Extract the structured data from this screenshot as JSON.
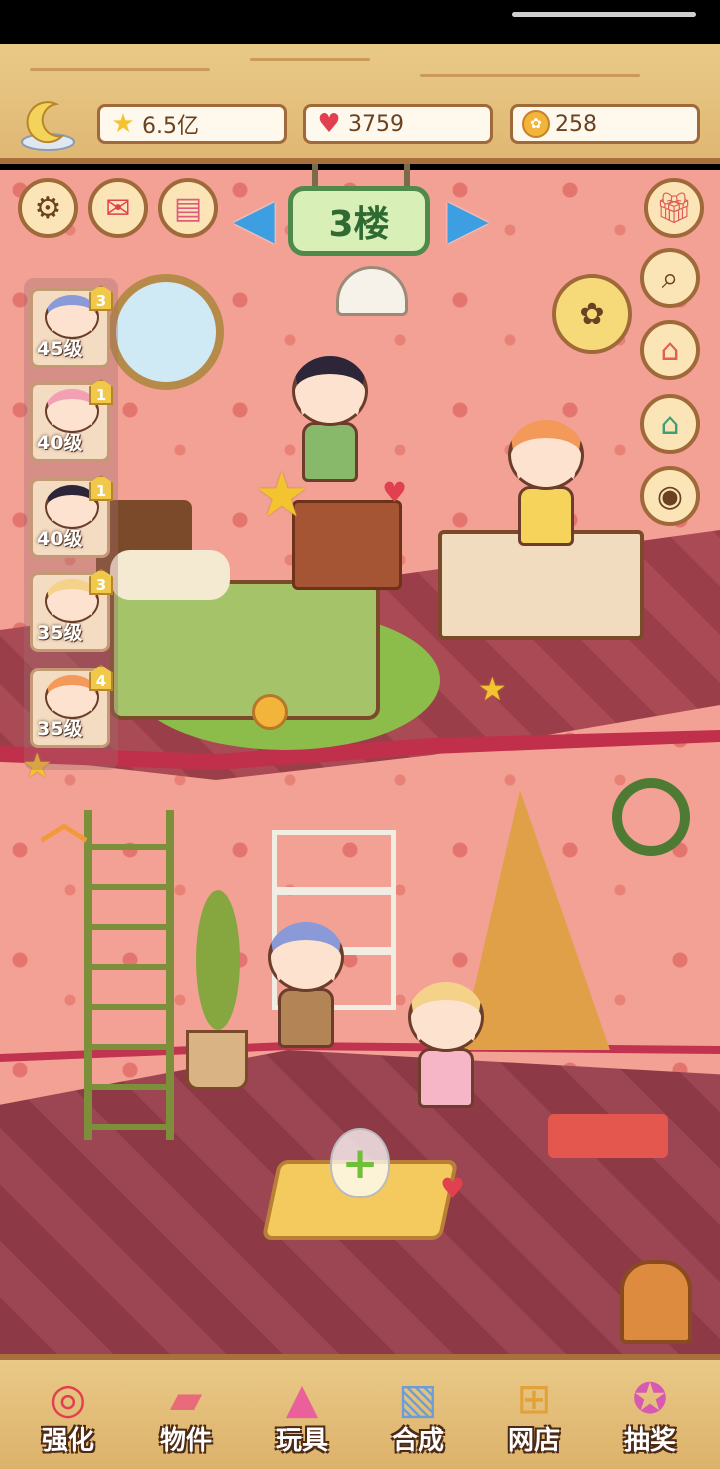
{
  "resources": {
    "stars": "6.5亿",
    "hearts": "3759",
    "coins": "258"
  },
  "floor": {
    "label": "3楼"
  },
  "roster": [
    {
      "level": "45级",
      "badge": "3"
    },
    {
      "level": "40级",
      "badge": "1"
    },
    {
      "level": "40级",
      "badge": "1"
    },
    {
      "level": "35级",
      "badge": "3"
    },
    {
      "level": "35级",
      "badge": "4"
    }
  ],
  "nav": [
    {
      "label": "强化",
      "icon": "lollipop-icon"
    },
    {
      "label": "物件",
      "icon": "piano-icon"
    },
    {
      "label": "玩具",
      "icon": "toy-blocks-icon"
    },
    {
      "label": "合成",
      "icon": "merge-cards-icon"
    },
    {
      "label": "网店",
      "icon": "shop-basket-icon"
    },
    {
      "label": "抽奖",
      "icon": "lottery-wheel-icon"
    }
  ],
  "colors": {
    "wood": "#e9c987",
    "wall": "#f3a195",
    "floor": "#9a3f4a",
    "accent_blue": "#3d9fe2",
    "sign_green": "#4f8a4b"
  }
}
